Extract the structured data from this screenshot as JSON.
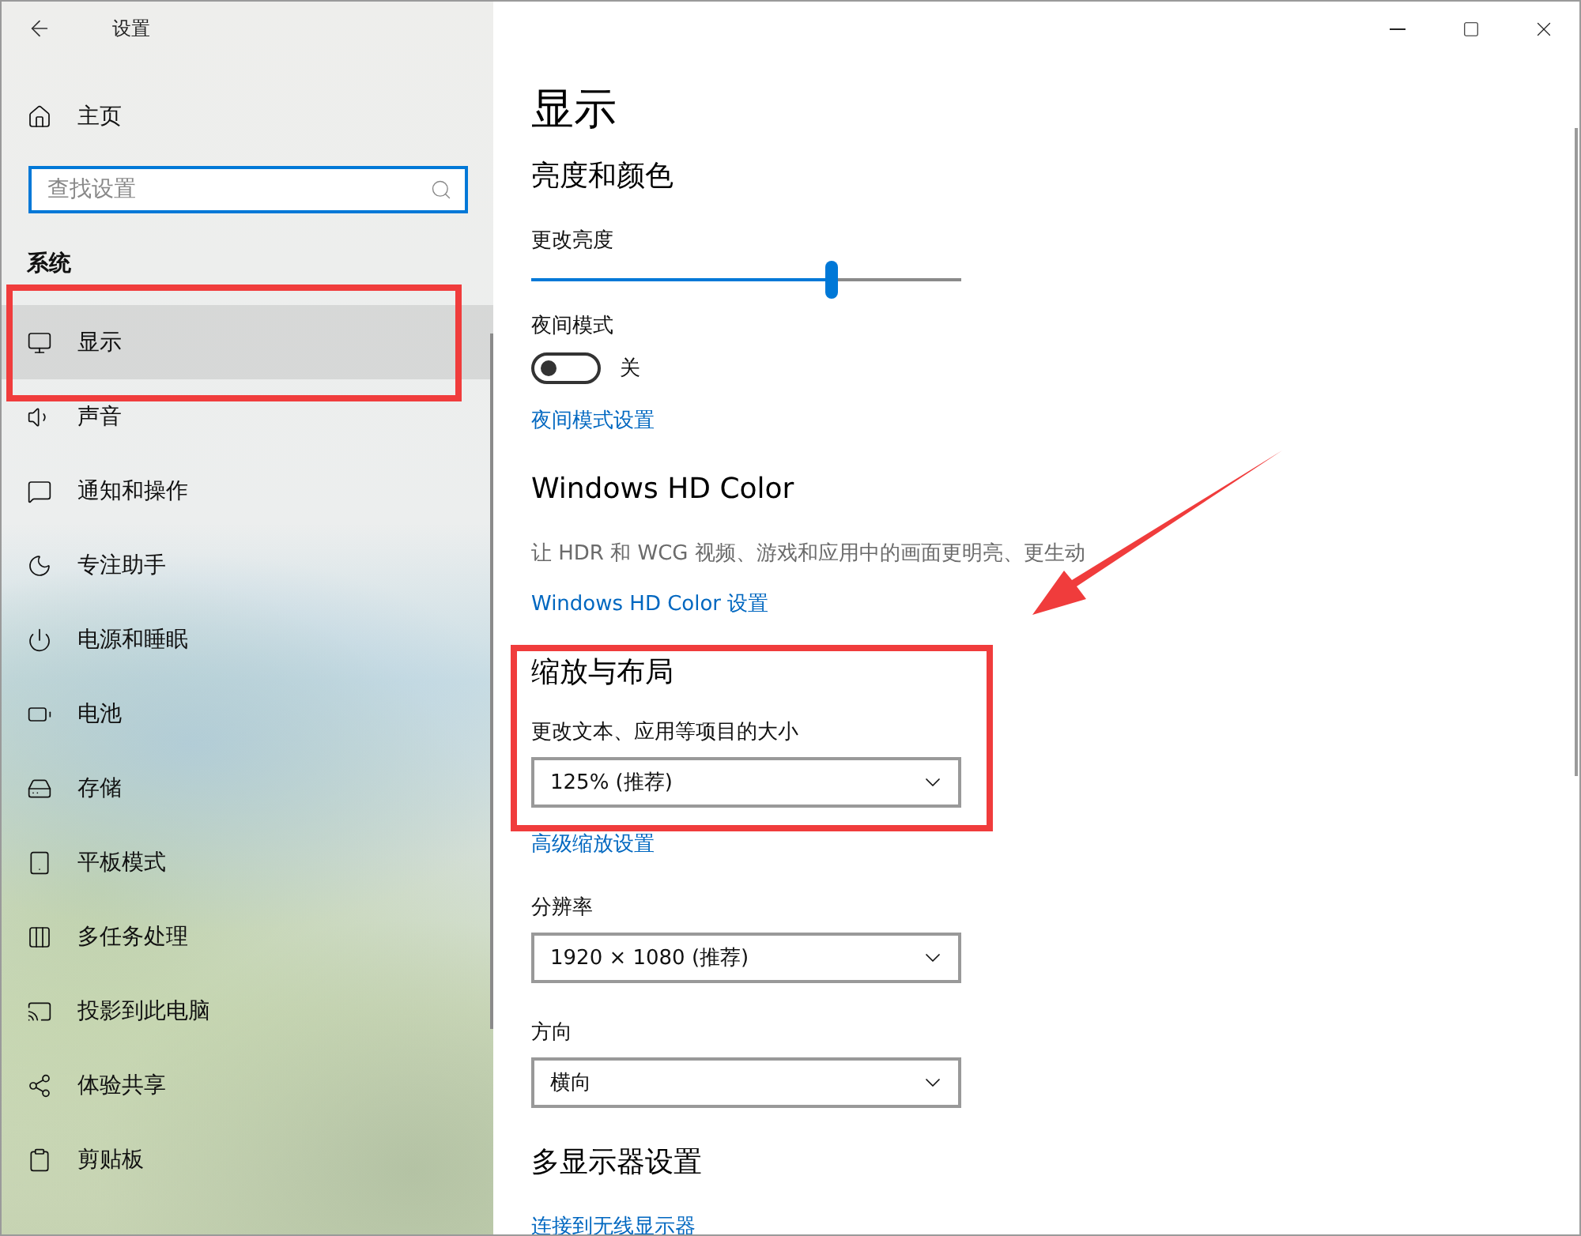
{
  "window": {
    "title": "设置"
  },
  "sidebar": {
    "home": "主页",
    "search": {
      "placeholder": "查找设置"
    },
    "group": "系统",
    "items": [
      {
        "label": "显示",
        "selected": true
      },
      {
        "label": "声音",
        "selected": false
      },
      {
        "label": "通知和操作",
        "selected": false
      },
      {
        "label": "专注助手",
        "selected": false
      },
      {
        "label": "电源和睡眠",
        "selected": false
      },
      {
        "label": "电池",
        "selected": false
      },
      {
        "label": "存储",
        "selected": false
      },
      {
        "label": "平板模式",
        "selected": false
      },
      {
        "label": "多任务处理",
        "selected": false
      },
      {
        "label": "投影到此电脑",
        "selected": false
      },
      {
        "label": "体验共享",
        "selected": false
      },
      {
        "label": "剪贴板",
        "selected": false
      }
    ]
  },
  "page": {
    "title": "显示",
    "sections": [
      {
        "heading": "亮度和颜色",
        "items": [
          {
            "kind": "slider",
            "label": "更改亮度",
            "level": 0.7
          },
          {
            "kind": "toggle",
            "label": "夜间模式",
            "on": false,
            "state_text": "关"
          },
          {
            "kind": "link",
            "text": "夜间模式设置"
          }
        ]
      },
      {
        "heading": "Windows HD Color",
        "items": [
          {
            "kind": "description",
            "text": "让 HDR 和 WCG 视频、游戏和应用中的画面更明亮、更生动"
          },
          {
            "kind": "link",
            "text": "Windows HD Color 设置"
          }
        ]
      },
      {
        "heading": "缩放与布局",
        "items": [
          {
            "kind": "dropdown",
            "label": "更改文本、应用等项目的大小",
            "value": "125% (推荐)"
          },
          {
            "kind": "link",
            "text": "高级缩放设置"
          },
          {
            "kind": "dropdown",
            "label": "分辨率",
            "value": "1920 × 1080 (推荐)"
          },
          {
            "kind": "dropdown",
            "label": "方向",
            "value": "横向"
          }
        ]
      },
      {
        "heading": "多显示器设置",
        "items": [
          {
            "kind": "link",
            "text": "连接到无线显示器"
          }
        ]
      }
    ]
  },
  "annotations": [
    {
      "kind": "box"
    },
    {
      "kind": "box"
    },
    {
      "kind": "arrow"
    }
  ]
}
